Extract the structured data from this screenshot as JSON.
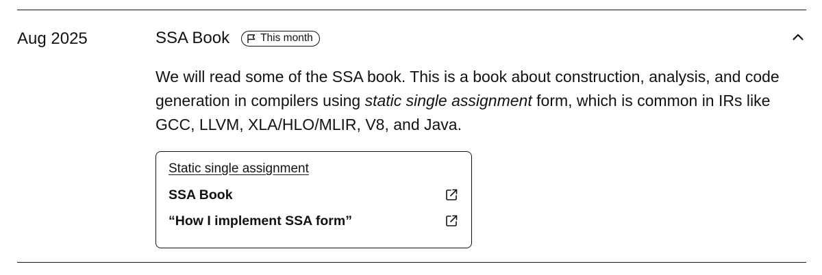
{
  "entry": {
    "date": "Aug 2025",
    "title": "SSA Book",
    "badge": {
      "icon": "flag-icon",
      "label": "This month"
    },
    "collapse_icon": "chevron-up-icon",
    "description": {
      "before": "We will read some of the SSA book. This is a book about construction, analysis, and code generation in compilers using ",
      "emphasis": "static single assignment",
      "after": " form, which is common in IRs like GCC, LLVM, XLA/HLO/MLIR, V8, and Java."
    },
    "references": {
      "heading": "Static single assignment",
      "items": [
        {
          "label": "SSA Book",
          "icon": "external-link-icon"
        },
        {
          "label": "“How I implement SSA form”",
          "icon": "external-link-icon"
        }
      ]
    }
  },
  "colors": {
    "text": "#111111",
    "background": "#ffffff",
    "rule": "#111111"
  }
}
